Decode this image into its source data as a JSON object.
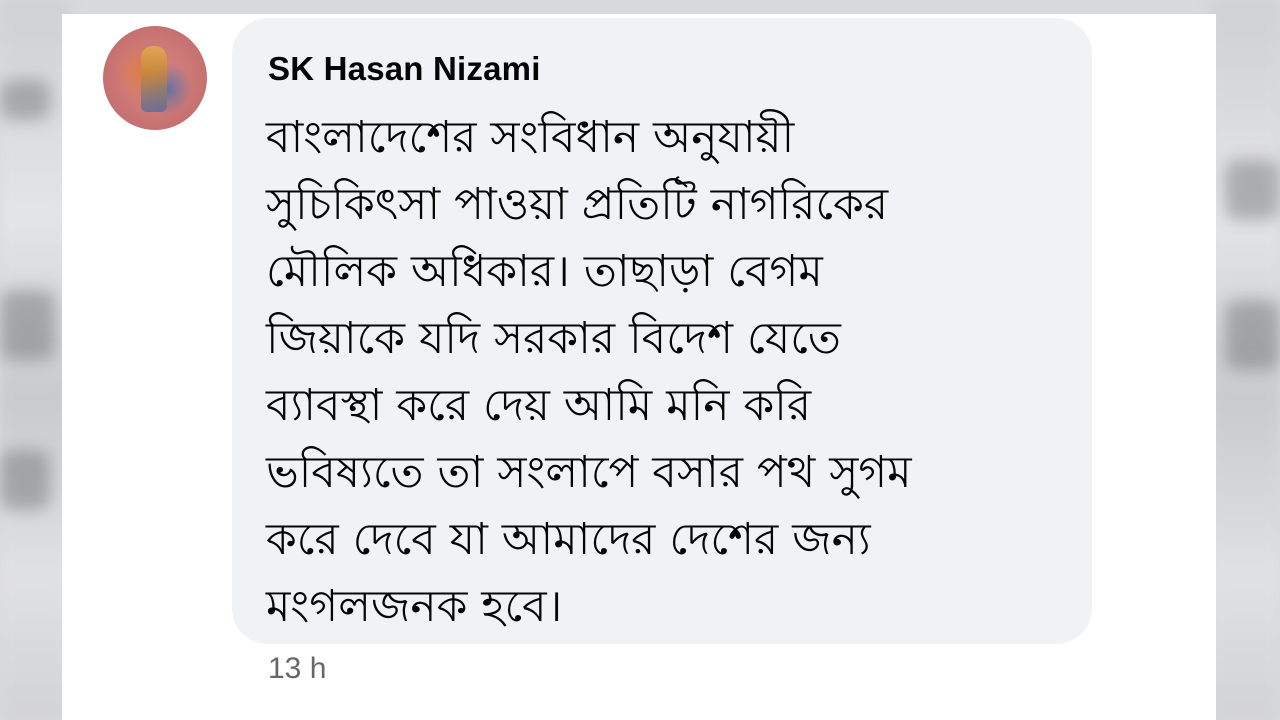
{
  "comment": {
    "author": "SK Hasan Nizami",
    "lines": [
      "বাংলাদেশের সংবিধান অনুযায়ী",
      "সুচিকিৎসা পাওয়া প্রতিটি নাগরিকের",
      "মৌলিক অধিকার। তাছাড়া বেগম",
      "জিয়াকে যদি সরকার বিদেশ যেতে",
      "ব্যাবস্থা করে দেয় আমি মনি করি",
      "ভবিষ্যতে তা সংলাপে বসার পথ সুগম",
      "করে দেবে যা আমাদের দেশের জন্য",
      "মংগলজনক হবে।"
    ],
    "timestamp": "13 h"
  },
  "colors": {
    "bubble": "#f0f2f5",
    "text": "#050505",
    "muted": "#65676b",
    "panel": "#ffffff"
  }
}
